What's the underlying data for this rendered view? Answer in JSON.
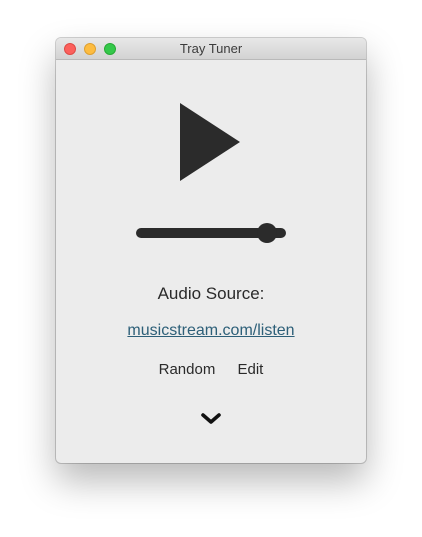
{
  "window": {
    "title": "Tray Tuner"
  },
  "player": {
    "play_icon": "play-icon",
    "volume_level": 0.93
  },
  "source": {
    "label": "Audio Source:",
    "url": "musicstream.com/listen"
  },
  "actions": {
    "random_label": "Random",
    "edit_label": "Edit"
  },
  "footer": {
    "expand_icon": "chevron-down-icon"
  },
  "colors": {
    "window_bg": "#ececec",
    "control": "#2b2b2b",
    "link": "#2d5f78",
    "close": "#fc605c",
    "minimize": "#fdbc40",
    "maximize": "#34c84a"
  }
}
